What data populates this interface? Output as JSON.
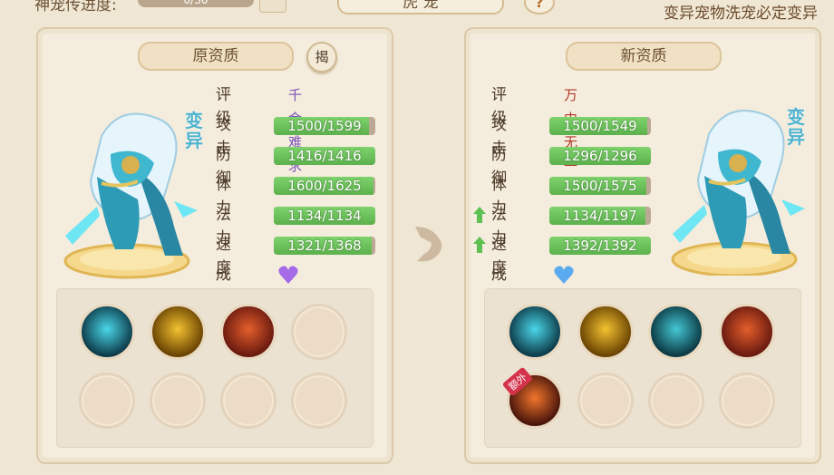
{
  "top": {
    "left_label": "神宠传进度:",
    "progress_text": "0/30",
    "center_tab": "虎 宠",
    "info_icon": "question-icon",
    "right_note": "变异宠物洗宠必定变异"
  },
  "left_panel": {
    "title": "原资质",
    "reveal_button": "揭",
    "mutation_tag": "变异",
    "stats": {
      "grade_label": "评级",
      "grade_value": "千金难求",
      "grade_color": "#7a52b8",
      "rows": [
        {
          "label": "攻击",
          "text": "1500/1599",
          "fill": 0.938
        },
        {
          "label": "防御",
          "text": "1416/1416",
          "fill": 1.0
        },
        {
          "label": "体力",
          "text": "1600/1625",
          "fill": 0.985
        },
        {
          "label": "法力",
          "text": "1134/1134",
          "fill": 1.0
        },
        {
          "label": "速度",
          "text": "1321/1368",
          "fill": 0.966
        }
      ],
      "growth_label": "成长",
      "growth_heart_color": "#a56be8"
    },
    "skills": [
      {
        "icon": "ice-warrior-skill-icon",
        "colors": [
          "#0e3c4b",
          "#49d7e8"
        ]
      },
      {
        "icon": "golden-slash-skill-icon",
        "colors": [
          "#6b4403",
          "#f3c230"
        ]
      },
      {
        "icon": "fire-beast-skill-icon",
        "colors": [
          "#6a1a10",
          "#e45e2b"
        ]
      },
      {
        "icon": "empty"
      },
      {
        "icon": "empty"
      },
      {
        "icon": "empty"
      },
      {
        "icon": "empty"
      },
      {
        "icon": "empty"
      }
    ]
  },
  "right_panel": {
    "title": "新资质",
    "mutation_tag": "变异",
    "stats": {
      "grade_label": "评级",
      "grade_value": "万中无一",
      "grade_color": "#b3382a",
      "rows": [
        {
          "label": "攻击",
          "text": "1500/1549",
          "fill": 0.968,
          "up": false
        },
        {
          "label": "防御",
          "text": "1296/1296",
          "fill": 1.0,
          "up": false
        },
        {
          "label": "体力",
          "text": "1500/1575",
          "fill": 0.952,
          "up": false
        },
        {
          "label": "法力",
          "text": "1134/1197",
          "fill": 0.947,
          "up": true
        },
        {
          "label": "速度",
          "text": "1392/1392",
          "fill": 1.0,
          "up": true
        }
      ],
      "growth_label": "成长",
      "growth_heart_color": "#5aaaf0"
    },
    "skills": [
      {
        "icon": "ice-warrior-skill-icon",
        "colors": [
          "#0e3c4b",
          "#49d7e8"
        ]
      },
      {
        "icon": "golden-slash-skill-icon",
        "colors": [
          "#6b4403",
          "#f3c230"
        ]
      },
      {
        "icon": "shadow-brute-skill-icon",
        "colors": [
          "#0c3a44",
          "#43c7d3"
        ]
      },
      {
        "icon": "fire-beast-skill-icon",
        "colors": [
          "#6a1a10",
          "#e45e2b"
        ]
      },
      {
        "icon": "fire-strike-skill-icon",
        "colors": [
          "#4a150b",
          "#f2762d"
        ],
        "extra_label": "额外"
      },
      {
        "icon": "empty"
      },
      {
        "icon": "empty"
      },
      {
        "icon": "empty"
      }
    ]
  }
}
